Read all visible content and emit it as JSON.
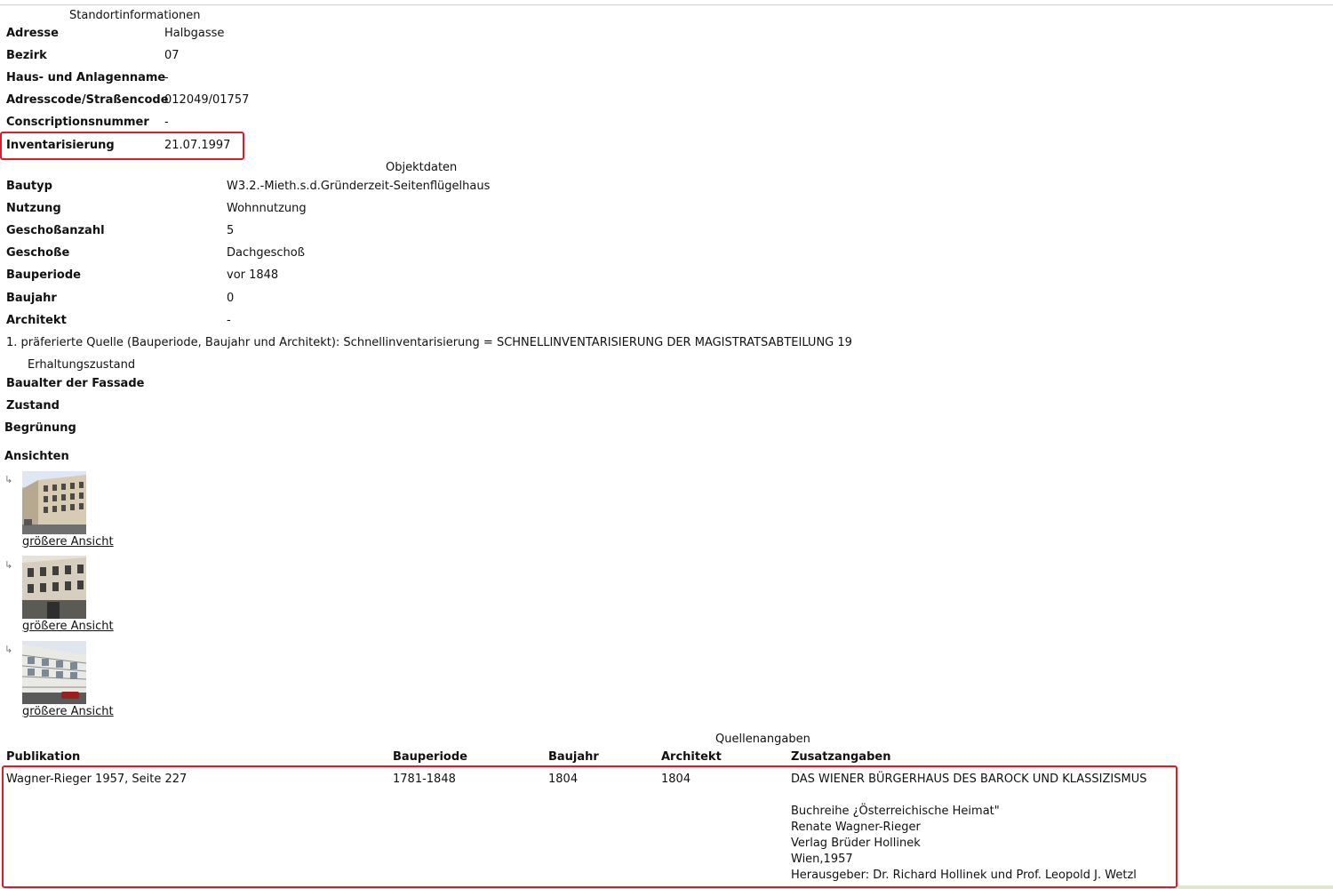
{
  "standort": {
    "caption": "Standortinformationen",
    "rows": [
      {
        "label": "Adresse",
        "value": "Halbgasse"
      },
      {
        "label": "Bezirk",
        "value": "07"
      },
      {
        "label": "Haus- und Anlagenname",
        "value": "-"
      },
      {
        "label": "Adresscode/Straßencode",
        "value": "012049/01757"
      },
      {
        "label": "Conscriptionsnummer",
        "value": "-"
      },
      {
        "label": "Inventarisierung",
        "value": "21.07.1997"
      }
    ]
  },
  "objekt": {
    "caption": "Objektdaten",
    "rows": [
      {
        "label": "Bautyp",
        "value": "W3.2.-Mieth.s.d.Gründerzeit-Seitenflügelhaus"
      },
      {
        "label": "Nutzung",
        "value": "Wohnnutzung"
      },
      {
        "label": "Geschoßanzahl",
        "value": "5"
      },
      {
        "label": "Geschoße",
        "value": "Dachgeschoß"
      },
      {
        "label": "Bauperiode",
        "value": "vor 1848"
      },
      {
        "label": "Baujahr",
        "value": "0"
      },
      {
        "label": "Architekt",
        "value": "-"
      }
    ],
    "note": "1. präferierte Quelle (Bauperiode, Baujahr und Architekt): Schnellinventarisierung = SCHNELLINVENTARISIERUNG DER MAGISTRATSABTEILUNG 19"
  },
  "erhaltung": {
    "caption": "Erhaltungszustand",
    "rows": [
      {
        "label": "Baualter der Fassade",
        "value": "-"
      },
      {
        "label": "Zustand",
        "value": ""
      }
    ]
  },
  "begruenung": {
    "label": "Begrünung"
  },
  "ansichten": {
    "heading": "Ansichten",
    "items": [
      {
        "link": "größere Ansicht"
      },
      {
        "link": "größere Ansicht"
      },
      {
        "link": "größere Ansicht"
      }
    ]
  },
  "quellen": {
    "caption": "Quellenangaben",
    "headers": [
      "Publikation",
      "Bauperiode",
      "Baujahr",
      "Architekt",
      "Zusatzangaben"
    ],
    "row": {
      "publikation": "Wagner-Rieger 1957, Seite 227",
      "bauperiode": "1781-1848",
      "baujahr": "1804",
      "architekt": "1804",
      "zusatz": [
        "DAS WIENER BÜRGERHAUS DES BAROCK UND KLASSIZISMUS",
        "Buchreihe ¿Österreichische Heimat\"",
        "Renate Wagner-Rieger",
        "Verlag Brüder Hollinek",
        "Wien,1957",
        "Herausgeber: Dr. Richard Hollinek und Prof. Leopold J. Wetzl"
      ]
    }
  },
  "colors": {
    "highlight": "#e0192b",
    "accent_bar": "#dfe9c7"
  }
}
